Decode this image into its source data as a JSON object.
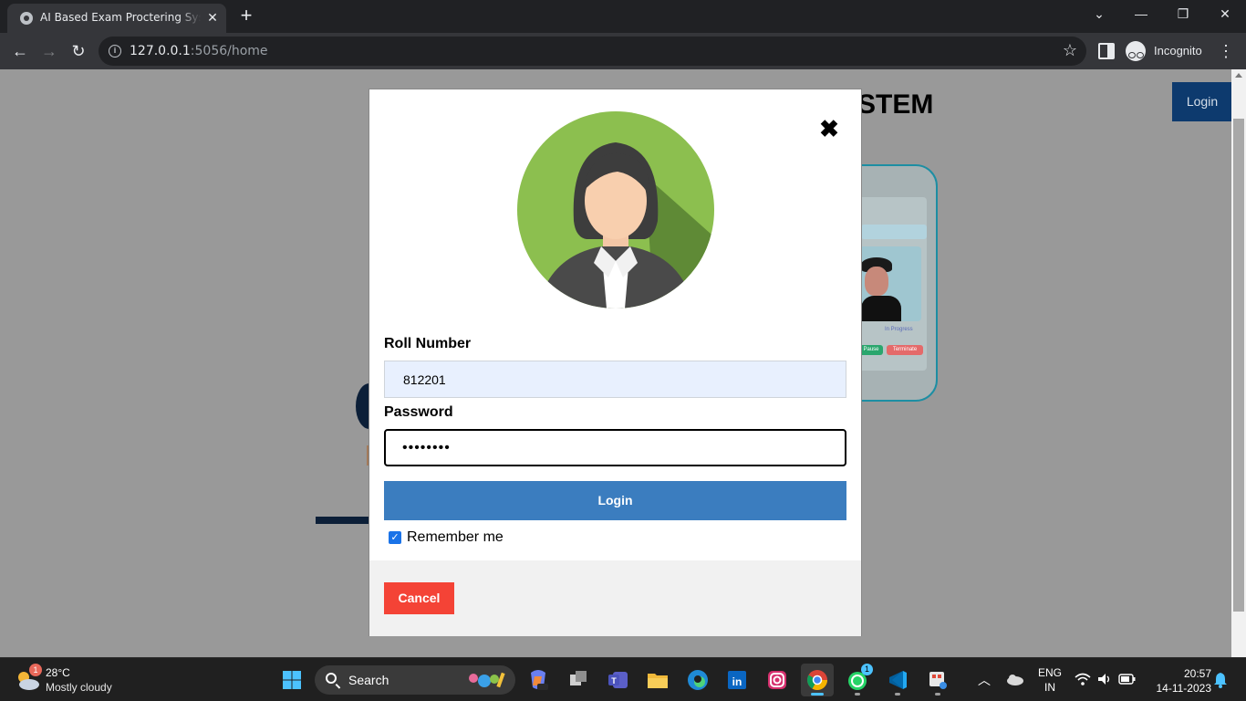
{
  "browser": {
    "tab_title": "AI Based Exam Proctering System",
    "url_host": "127.0.0.1",
    "url_path": ":5056/home",
    "profile_label": "Incognito"
  },
  "page": {
    "title_fragment": "STEM",
    "nav_login_label": "Login",
    "illustration": {
      "status_label": "In Progress",
      "pause_label": "Pause",
      "terminate_label": "Terminate"
    }
  },
  "login_modal": {
    "roll_label": "Roll Number",
    "roll_value": "812201",
    "password_label": "Password",
    "password_value": "••••••••",
    "login_button": "Login",
    "remember_label": "Remember me",
    "remember_checked": true,
    "cancel_button": "Cancel"
  },
  "taskbar": {
    "weather_badge": "1",
    "weather_temp": "28°C",
    "weather_desc": "Mostly cloudy",
    "search_label": "Search",
    "whatsapp_badge": "1",
    "language_top": "ENG",
    "language_bottom": "IN",
    "time": "20:57",
    "date": "14-11-2023"
  },
  "colors": {
    "modal_login_button": "#3b7dbf",
    "cancel_button": "#f44336",
    "nav_login": "#0d3a6e",
    "overlay": "#999999"
  }
}
